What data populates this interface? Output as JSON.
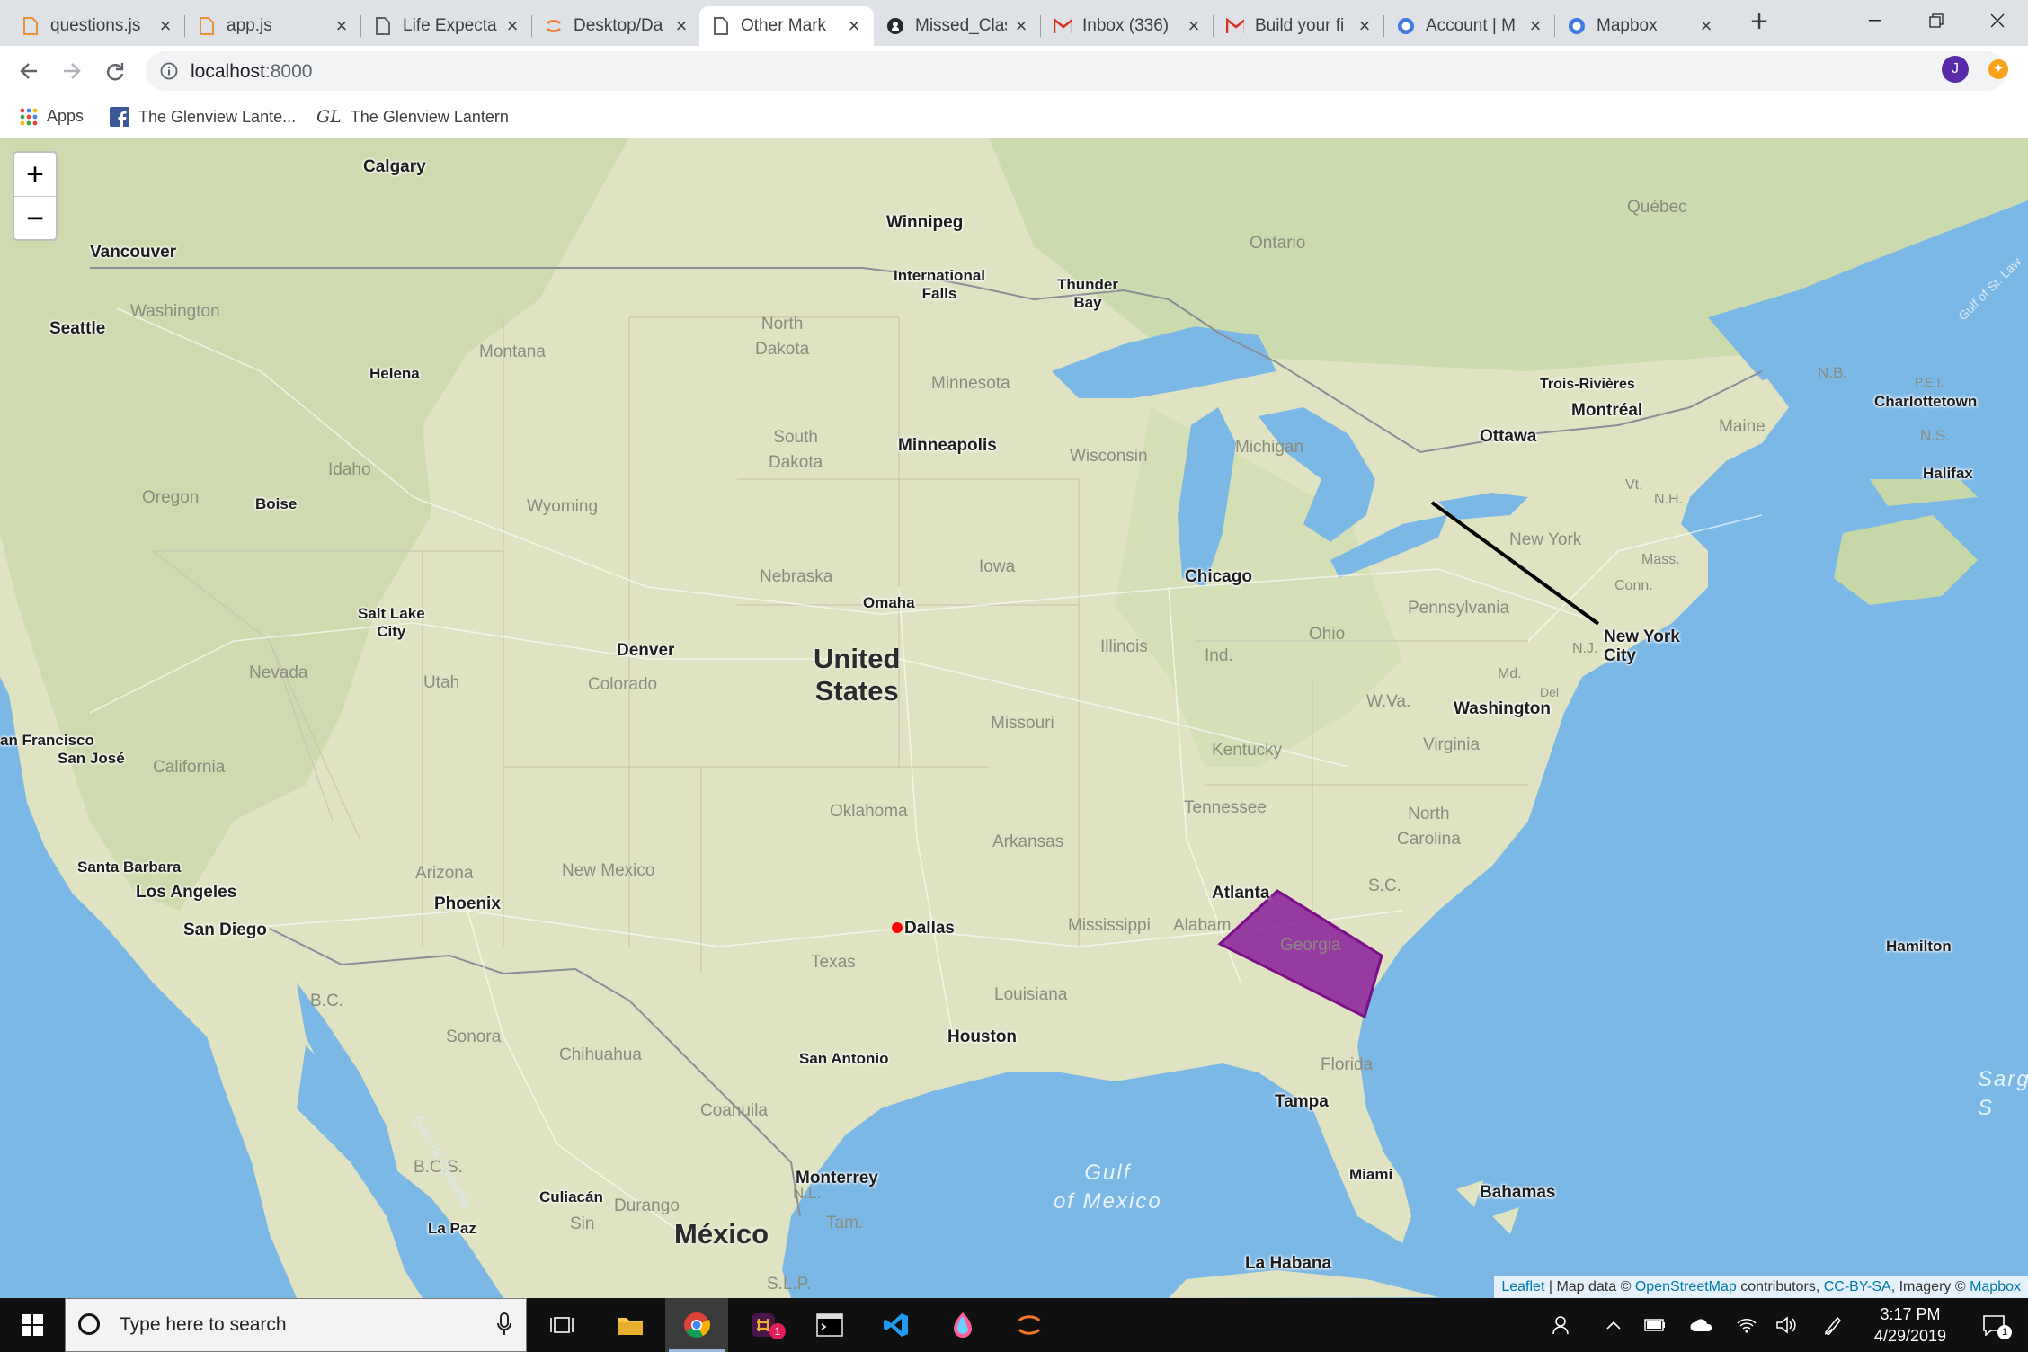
{
  "tabs": [
    {
      "title": "questions.js",
      "icon": "file-icon"
    },
    {
      "title": "app.js",
      "icon": "file-icon"
    },
    {
      "title": "Life Expecta",
      "icon": "page-icon"
    },
    {
      "title": "Desktop/Da",
      "icon": "jupyter-icon"
    },
    {
      "title": "Other Mark",
      "icon": "page-icon",
      "active": true
    },
    {
      "title": "Missed_Clas",
      "icon": "github-icon"
    },
    {
      "title": "Inbox (336)",
      "icon": "gmail-icon"
    },
    {
      "title": "Build your fi",
      "icon": "gmail-icon"
    },
    {
      "title": "Account | M",
      "icon": "mapbox-icon"
    },
    {
      "title": "Mapbox",
      "icon": "mapbox-icon"
    }
  ],
  "toolbar": {
    "url_host": "localhost",
    "url_port": ":8000",
    "avatar_letter": "J"
  },
  "bookmarks": {
    "apps": "Apps",
    "item1": "The Glenview Lante...",
    "item2": "The Glenview Lantern"
  },
  "map": {
    "zoom_in": "+",
    "zoom_out": "−",
    "country_us": "United\nStates",
    "country_mx": "México",
    "gulf": "Gulf\nof Mexico",
    "sarg": "Sarg\nS",
    "cities": {
      "calgary": "Calgary",
      "winnipeg": "Winnipeg",
      "vancouver": "Vancouver",
      "seattle": "Seattle",
      "helena": "Helena",
      "boise": "Boise",
      "saltlake": "Salt Lake\nCity",
      "denver": "Denver",
      "sanfrancisco": "an Francisco",
      "sanjose": "San José",
      "santabarbara": "Santa Barbara",
      "losangeles": "Los Angeles",
      "sandiego": "San Diego",
      "phoenix": "Phoenix",
      "intlfalls": "International\nFalls",
      "thunderbay": "Thunder\nBay",
      "minneapolis": "Minneapolis",
      "omaha": "Omaha",
      "chicago": "Chicago",
      "dallas": "Dallas",
      "houston": "Houston",
      "sanantonio": "San Antonio",
      "atlanta": "Atlanta",
      "tampa": "Tampa",
      "miami": "Miami",
      "monterrey": "Monterrey",
      "culiacan": "Culiacán",
      "lapaz": "La Paz",
      "lahabana": "La Habana",
      "bahamas": "Bahamas",
      "washington": "Washington",
      "newyork": "New York\nCity",
      "ottawa": "Ottawa",
      "montreal": "Montréal",
      "troisrivieres": "Trois-Rivières",
      "charlottetown": "Charlottetown",
      "halifax": "Halifax",
      "hamilton": "Hamilton"
    },
    "states": {
      "washington": "Washington",
      "oregon": "Oregon",
      "idaho": "Idaho",
      "montana": "Montana",
      "wyoming": "Wyoming",
      "nevada": "Nevada",
      "utah": "Utah",
      "colorado": "Colorado",
      "california": "California",
      "arizona": "Arizona",
      "newmexico": "New Mexico",
      "northdakota": "North\nDakota",
      "southdakota": "South\nDakota",
      "nebraska": "Nebraska",
      "minnesota": "Minnesota",
      "iowa": "Iowa",
      "wisconsin": "Wisconsin",
      "michigan": "Michigan",
      "illinois": "Illinois",
      "ind": "Ind.",
      "ohio": "Ohio",
      "missouri": "Missouri",
      "oklahoma": "Oklahoma",
      "arkansas": "Arkansas",
      "texas": "Texas",
      "louisiana": "Louisiana",
      "mississippi": "Mississippi",
      "alabama": "Alabam",
      "georgia": "Georgia",
      "tennessee": "Tennessee",
      "kentucky": "Kentucky",
      "wva": "W.Va.",
      "virginia": "Virginia",
      "northcarolina": "North\nCarolina",
      "sc": "S.C.",
      "florida": "Florida",
      "pennsylvania": "Pennsylvania",
      "newyork": "New York",
      "nj": "N.J.",
      "md": "Md.",
      "del": "Del",
      "conn": "Conn.",
      "mass": "Mass.",
      "vt": "Vt.",
      "nh": "N.H.",
      "maine": "Maine",
      "nb": "N.B.",
      "ns": "N.S.",
      "pei": "P.E.I.",
      "quebec": "Québec",
      "ontario": "Ontario",
      "bc": "B.C.",
      "sonora": "Sonora",
      "chihuahua": "Chihuahua",
      "coahuila": "Coahuila",
      "nl": "N.L.",
      "tam": "Tam.",
      "bcs": "B.C.S.",
      "sin": "Sin",
      "durango": "Durango",
      "slp": "S.L.P.",
      "gulfcal": "Golfo de California",
      "gulfstlaw": "Gulf of St. Law"
    },
    "attribution": {
      "leaflet": "Leaflet",
      "sep": " | Map data © ",
      "osm": "OpenStreetMap",
      "contrib": " contributors, ",
      "ccbysa": "CC-BY-SA",
      "imagery": ", Imagery © ",
      "mapbox": "Mapbox"
    },
    "overlay_colors": {
      "polygon_fill": "#8a1f9b",
      "polygon_stroke": "#7a0f8a",
      "line": "#000000",
      "marker": "#ff0000",
      "water": "#7cb8e6",
      "land": "#dfe3c2"
    }
  },
  "taskbar": {
    "search_placeholder": "Type here to search",
    "time": "3:17 PM",
    "date": "4/29/2019",
    "slack_badge": "1",
    "notif_count": "1"
  }
}
